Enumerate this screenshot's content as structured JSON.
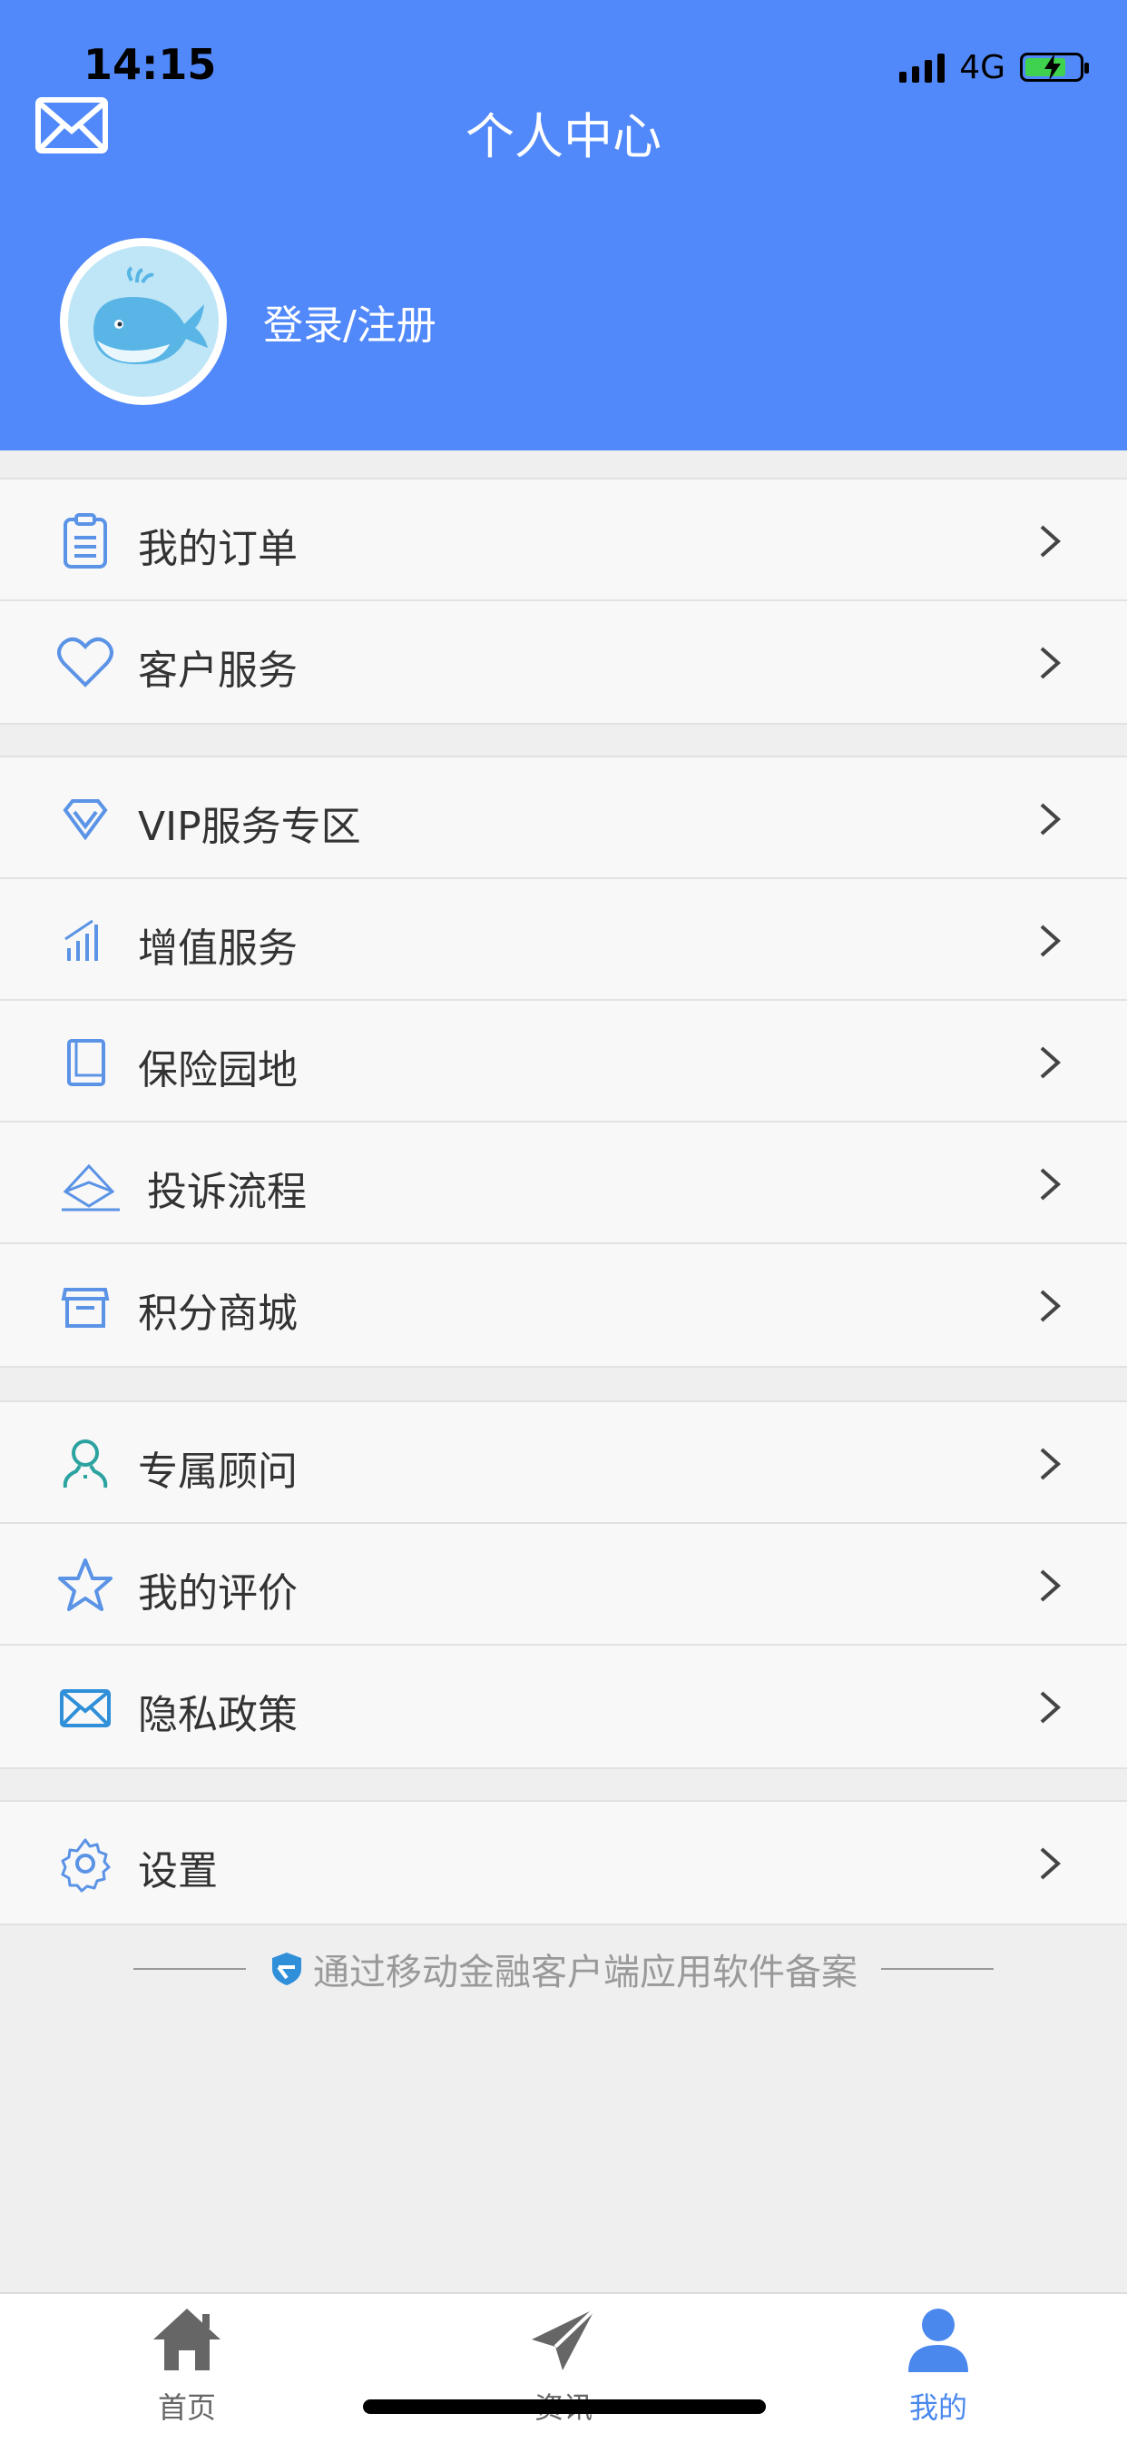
{
  "status": {
    "time": "14:15",
    "network": "4G"
  },
  "header": {
    "title": "个人中心",
    "login_label": "登录/注册"
  },
  "menu_groups": [
    [
      {
        "label": "我的订单",
        "icon": "clipboard-icon"
      },
      {
        "label": "客户服务",
        "icon": "heart-icon"
      }
    ],
    [
      {
        "label": "VIP服务专区",
        "icon": "diamond-icon"
      },
      {
        "label": "增值服务",
        "icon": "bar-chart-icon"
      },
      {
        "label": "保险园地",
        "icon": "book-icon"
      },
      {
        "label": "投诉流程",
        "icon": "envelope-open-icon"
      },
      {
        "label": "积分商城",
        "icon": "store-icon"
      }
    ],
    [
      {
        "label": "专属顾问",
        "icon": "advisor-icon"
      },
      {
        "label": "我的评价",
        "icon": "star-icon"
      },
      {
        "label": "隐私政策",
        "icon": "mail-icon"
      }
    ],
    [
      {
        "label": "设置",
        "icon": "gear-icon"
      }
    ]
  ],
  "footer_note": "通过移动金融客户端应用软件备案",
  "tabs": [
    {
      "label": "首页",
      "icon": "home-icon"
    },
    {
      "label": "资讯",
      "icon": "paper-plane-icon"
    },
    {
      "label": "我的",
      "icon": "person-icon"
    }
  ],
  "colors": {
    "brand": "#5289fa",
    "active_tab": "#4a88ee",
    "icon_blue": "#5b93e6",
    "icon_teal": "#2ba3a0"
  }
}
